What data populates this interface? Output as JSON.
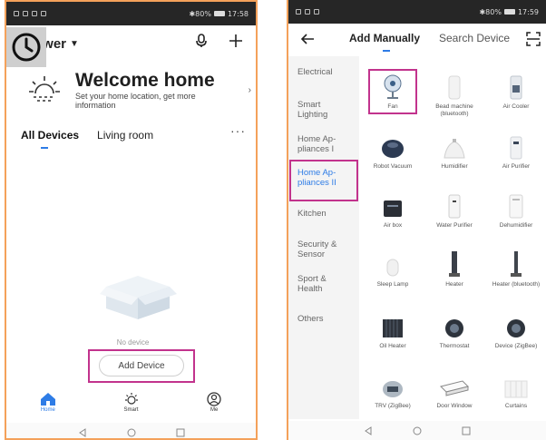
{
  "left_phone": {
    "status": {
      "battery": "✱80%",
      "time": "17:58"
    },
    "home_name": "ower",
    "welcome": {
      "title": "Welcome home",
      "subtitle": "Set your home location, get more information"
    },
    "tabs": [
      {
        "label": "All Devices",
        "active": true
      },
      {
        "label": "Living room",
        "active": false
      }
    ],
    "empty_label": "No device",
    "add_device_label": "Add Device",
    "nav": [
      {
        "label": "Home",
        "active": true
      },
      {
        "label": "Smart",
        "active": false
      },
      {
        "label": "Me",
        "active": false
      }
    ]
  },
  "right_phone": {
    "status": {
      "battery": "✱80%",
      "time": "17:59"
    },
    "tabs": [
      {
        "label": "Add Manually",
        "active": true
      },
      {
        "label": "Search Device",
        "active": false
      }
    ],
    "categories": [
      {
        "label": "Electrical",
        "active": false
      },
      {
        "label": "Smart Lighting",
        "active": false
      },
      {
        "label": "Home Ap- pliances I",
        "active": false
      },
      {
        "label": "Home Ap- pliances II",
        "active": true
      },
      {
        "label": "Kitchen",
        "active": false
      },
      {
        "label": "Security & Sensor",
        "active": false
      },
      {
        "label": "Sport & Health",
        "active": false
      },
      {
        "label": "Others",
        "active": false
      }
    ],
    "devices": [
      {
        "name": "Fan",
        "icon": "fan-icon"
      },
      {
        "name": "Bead machine (bluetooth)",
        "icon": "bead-machine-icon"
      },
      {
        "name": "Air Cooler",
        "icon": "air-cooler-icon"
      },
      {
        "name": "Robot Vacuum",
        "icon": "robot-vacuum-icon"
      },
      {
        "name": "Humidifier",
        "icon": "humidifier-icon"
      },
      {
        "name": "Air Purifier",
        "icon": "air-purifier-icon"
      },
      {
        "name": "Air box",
        "icon": "air-box-icon"
      },
      {
        "name": "Water Purifier",
        "icon": "water-purifier-icon"
      },
      {
        "name": "Dehumidifier",
        "icon": "dehumidifier-icon"
      },
      {
        "name": "Sleep Lamp",
        "icon": "sleep-lamp-icon"
      },
      {
        "name": "Heater",
        "icon": "heater-icon"
      },
      {
        "name": "Heater (bluetooth)",
        "icon": "heater-bluetooth-icon"
      },
      {
        "name": "Oil Heater",
        "icon": "oil-heater-icon"
      },
      {
        "name": "Thermostat",
        "icon": "thermostat-icon"
      },
      {
        "name": "Device (ZigBee)",
        "icon": "zigbee-device-icon"
      },
      {
        "name": "TRV (ZigBee)",
        "icon": "trv-icon"
      },
      {
        "name": "Door Window",
        "icon": "door-window-icon"
      },
      {
        "name": "Curtains",
        "icon": "curtains-icon"
      }
    ]
  },
  "colors": {
    "accent": "#2e7ce6",
    "highlight": "#c2338d",
    "phone_border": "#f4a15a"
  }
}
